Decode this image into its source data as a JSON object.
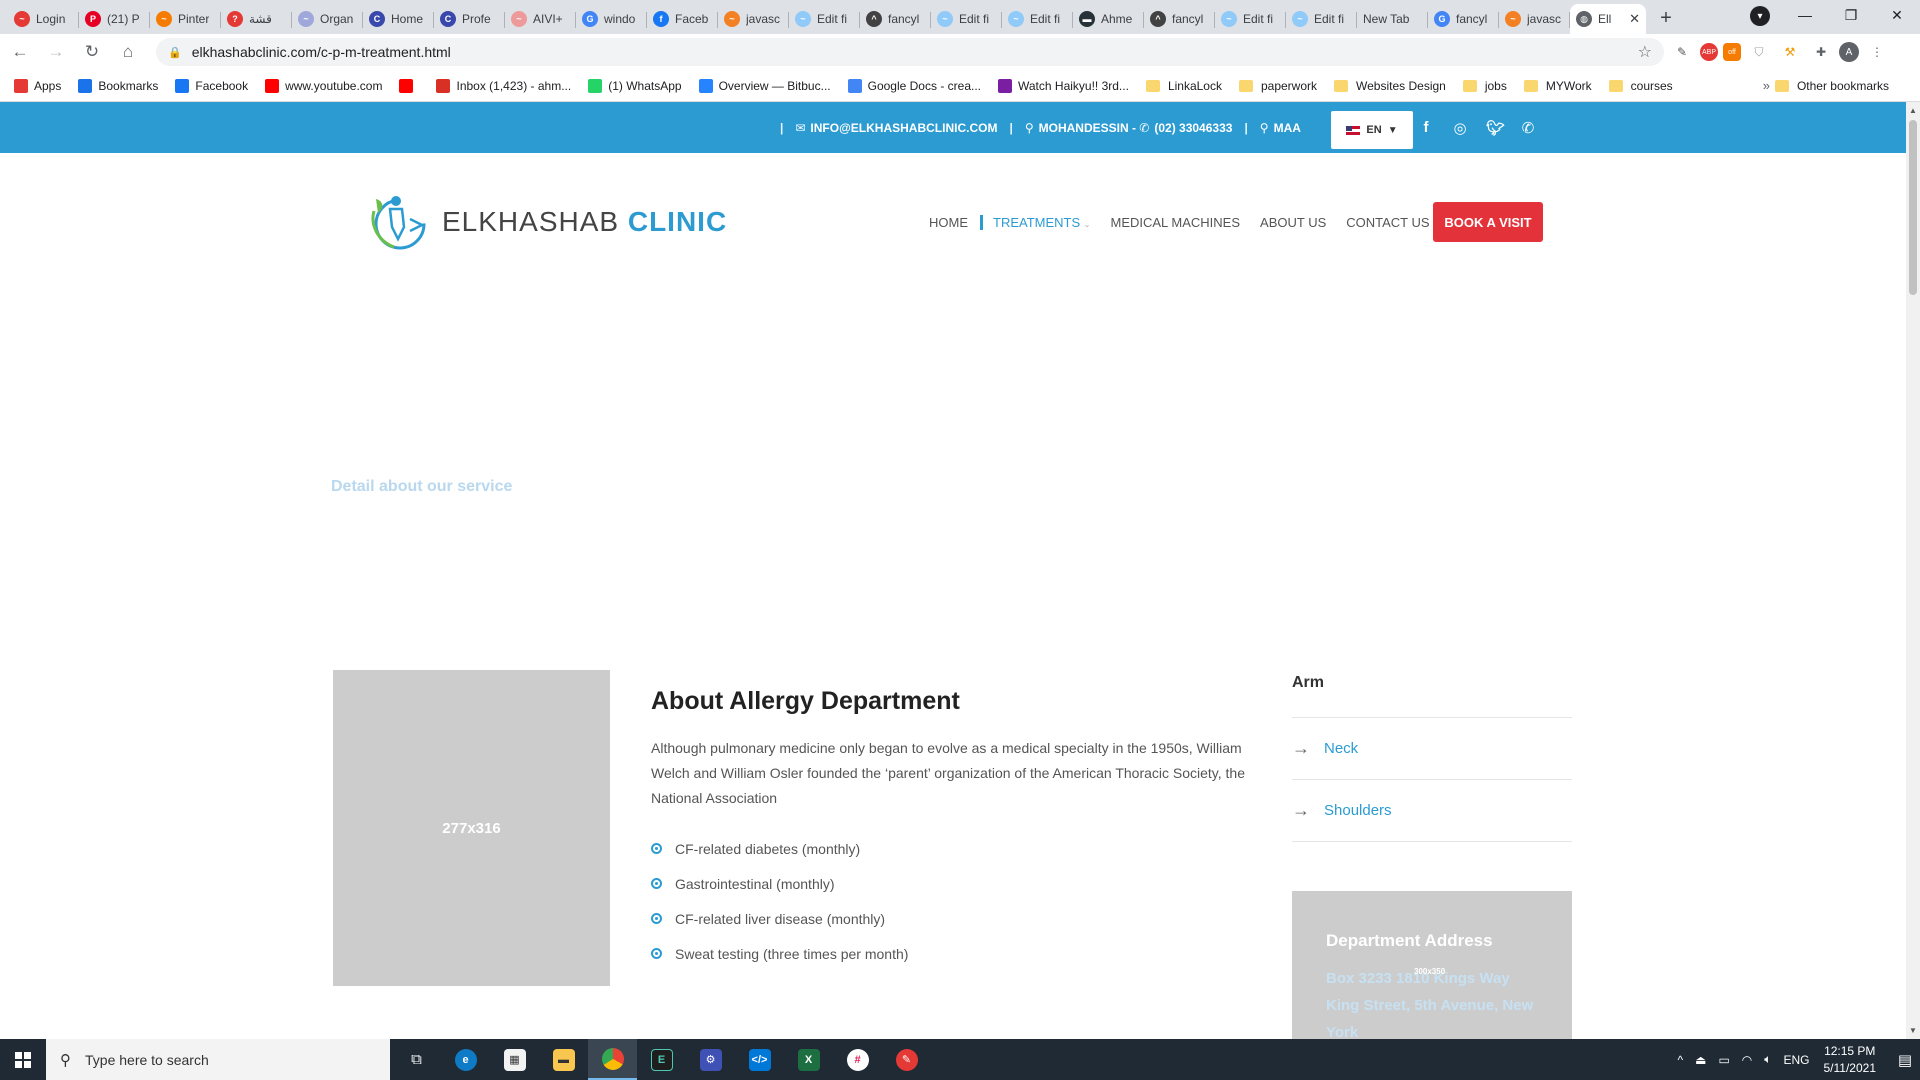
{
  "browser": {
    "tabs": [
      {
        "label": "Login",
        "color": "#e53935",
        "glyph": "~"
      },
      {
        "label": "(21) P",
        "color": "#e60023",
        "glyph": "P"
      },
      {
        "label": "Pinter",
        "color": "#f57c00",
        "glyph": "~"
      },
      {
        "label": "قشة",
        "color": "#e53935",
        "glyph": "?"
      },
      {
        "label": "Organ",
        "color": "#9fa8da",
        "glyph": "~"
      },
      {
        "label": "Home",
        "color": "#3949ab",
        "glyph": "C"
      },
      {
        "label": "Profe",
        "color": "#3949ab",
        "glyph": "C"
      },
      {
        "label": "AIVI+",
        "color": "#ef9a9a",
        "glyph": "~"
      },
      {
        "label": "windo",
        "color": "#4285f4",
        "glyph": "G"
      },
      {
        "label": "Faceb",
        "color": "#1877f2",
        "glyph": "f"
      },
      {
        "label": "javasc",
        "color": "#f48024",
        "glyph": "~"
      },
      {
        "label": "Edit fi",
        "color": "#90caf9",
        "glyph": "~"
      },
      {
        "label": "fancyl",
        "color": "#424242",
        "glyph": "^"
      },
      {
        "label": "Edit fi",
        "color": "#90caf9",
        "glyph": "~"
      },
      {
        "label": "Edit fi",
        "color": "#90caf9",
        "glyph": "~"
      },
      {
        "label": "Ahme",
        "color": "#263238",
        "glyph": "▬"
      },
      {
        "label": "fancyl",
        "color": "#424242",
        "glyph": "^"
      },
      {
        "label": "Edit fi",
        "color": "#90caf9",
        "glyph": "~"
      },
      {
        "label": "Edit fi",
        "color": "#90caf9",
        "glyph": "~"
      },
      {
        "label": "New Tab",
        "color": "",
        "glyph": ""
      },
      {
        "label": "fancyl",
        "color": "#4285f4",
        "glyph": "G"
      },
      {
        "label": "javasc",
        "color": "#f48024",
        "glyph": "~"
      }
    ],
    "active_tab": {
      "label": "Ell",
      "color": "#5f6368",
      "glyph": "◍"
    },
    "new_tab_glyph": "+",
    "url": "elkhashabclinic.com/c-p-m-treatment.html",
    "bookmarks": [
      {
        "label": "Apps",
        "icon": "apps-grid-icon",
        "color": "#e53935"
      },
      {
        "label": "Bookmarks",
        "icon": "star-icon",
        "color": "#1a73e8"
      },
      {
        "label": "Facebook",
        "icon": "facebook-icon",
        "color": "#1877f2"
      },
      {
        "label": "www.youtube.com",
        "icon": "youtube-icon",
        "color": "#ff0000"
      },
      {
        "label": "",
        "icon": "youtube-icon",
        "color": "#ff0000"
      },
      {
        "label": "Inbox (1,423) - ahm...",
        "icon": "gmail-icon",
        "color": "#d93025"
      },
      {
        "label": "(1) WhatsApp",
        "icon": "whatsapp-icon",
        "color": "#25d366"
      },
      {
        "label": "Overview — Bitbuc...",
        "icon": "bitbucket-icon",
        "color": "#2684ff"
      },
      {
        "label": "Google Docs - crea...",
        "icon": "docs-icon",
        "color": "#4285f4"
      },
      {
        "label": "Watch Haikyu!! 3rd...",
        "icon": "play-icon",
        "color": "#7b1fa2"
      }
    ],
    "bookmark_folders": [
      "LinkaLock",
      "paperwork",
      "Websites Design",
      "jobs",
      "MYWork",
      "courses"
    ],
    "other_bookmarks": "Other bookmarks"
  },
  "site": {
    "topbar": {
      "email": "INFO@ELKHASHABCLINIC.COM",
      "location": "MOHANDESSIN -",
      "phone": "(02) 33046333",
      "location2": "MAA",
      "lang": "EN"
    },
    "brand_left": "ELKHASHAB",
    "brand_right": "CLINIC",
    "nav": {
      "home": "HOME",
      "treatments": "TREATMENTS",
      "machines": "MEDICAL MACHINES",
      "about": "ABOUT US",
      "contact": "CONTACT US",
      "book": "BOOK A VISIT"
    },
    "hero_subtitle": "Detail about our service",
    "image_placeholder": "277x316",
    "about": {
      "title": "About Allergy Department",
      "body": "Although pulmonary medicine only began to evolve as a medical specialty in the 1950s, William Welch and William Osler founded the ‘parent’ organization of the American Thoracic Society, the National Association",
      "items": [
        "CF-related diabetes (monthly)",
        "Gastrointestinal (monthly)",
        "CF-related liver disease (monthly)",
        "Sweat testing (three times per month)"
      ]
    },
    "sidebar": {
      "title": "Arm",
      "links": [
        "Neck",
        "Shoulders"
      ]
    },
    "address_box": {
      "title": "Department Address",
      "placeholder_tag": "300x350",
      "text": "Box 3233 1810 Kings Way King Street, 5th Avenue, New York"
    }
  },
  "taskbar": {
    "search_placeholder": "Type here to search",
    "lang": "ENG",
    "time": "12:15 PM",
    "date": "5/11/2021"
  }
}
